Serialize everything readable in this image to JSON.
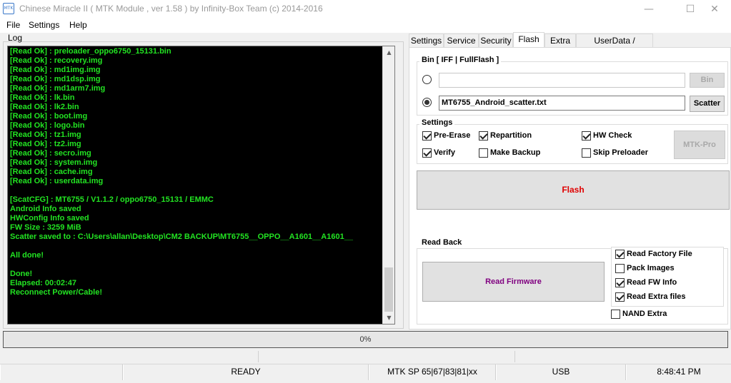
{
  "window": {
    "title": "Chinese Miracle II ( MTK Module , ver 1.58 ) by Infinity-Box Team (c) 2014-2016",
    "icon_text": "MTK"
  },
  "menu": [
    "File",
    "Settings",
    "Help"
  ],
  "log": {
    "label": "Log",
    "lines": [
      "[Read Ok] : preloader_oppo6750_15131.bin",
      "[Read Ok] : recovery.img",
      "[Read Ok] : md1img.img",
      "[Read Ok] : md1dsp.img",
      "[Read Ok] : md1arm7.img",
      "[Read Ok] : lk.bin",
      "[Read Ok] : lk2.bin",
      "[Read Ok] : boot.img",
      "[Read Ok] : logo.bin",
      "[Read Ok] : tz1.img",
      "[Read Ok] : tz2.img",
      "[Read Ok] : secro.img",
      "[Read Ok] : system.img",
      "[Read Ok] : cache.img",
      "[Read Ok] : userdata.img",
      "",
      "[ScatCFG] : MT6755 / V1.1.2 / oppo6750_15131 / EMMC",
      "Android Info saved",
      "HWConfig Info saved",
      "FW Size : 3259 MiB",
      "Scatter saved to : C:\\Users\\allan\\Desktop\\CM2 BACKUP\\MT6755__OPPO__A1601__A1601__",
      "",
      "All done!",
      "",
      "Done!",
      "Elapsed: 00:02:47",
      "Reconnect Power/Cable!"
    ]
  },
  "tabs": [
    "Settings",
    "Service",
    "Security",
    "Flash",
    "Extra",
    "UserData / Forensic"
  ],
  "active_tab": "Flash",
  "bin_group": {
    "title": "Bin  [ IFF | FullFlash ]",
    "bin_value": "",
    "bin_button": "Bin",
    "scatter_value": "MT6755_Android_scatter.txt",
    "scatter_button": "Scatter"
  },
  "settings_group": {
    "title": "Settings",
    "options": [
      {
        "label": "Pre-Erase",
        "checked": true
      },
      {
        "label": "Repartition",
        "checked": true
      },
      {
        "label": "HW Check",
        "checked": true
      },
      {
        "label": "Verify",
        "checked": true
      },
      {
        "label": "Make Backup",
        "checked": false
      },
      {
        "label": "Skip Preloader",
        "checked": false
      }
    ],
    "mtk_pro_button": "MTK-Pro"
  },
  "flash_button": "Flash",
  "readback_group": {
    "title": "Read Back",
    "read_firmware_button": "Read Firmware",
    "options": [
      {
        "label": "Read Factory File",
        "checked": true
      },
      {
        "label": "Pack Images",
        "checked": false
      },
      {
        "label": "Read FW Info",
        "checked": true
      },
      {
        "label": "Read Extra files",
        "checked": true
      }
    ],
    "nand_extra": {
      "label": "NAND Extra",
      "checked": false
    }
  },
  "progress": {
    "value": 0,
    "label": "0%"
  },
  "status": {
    "state": "READY",
    "chipset": "MTK SP 65|67|83|81|xx",
    "connection": "USB",
    "time": "8:48:41 PM"
  },
  "colors": {
    "log_text": "#22e322",
    "log_bg": "#000000",
    "flash_button_text": "#e00000",
    "read_firmware_text": "#800080"
  }
}
